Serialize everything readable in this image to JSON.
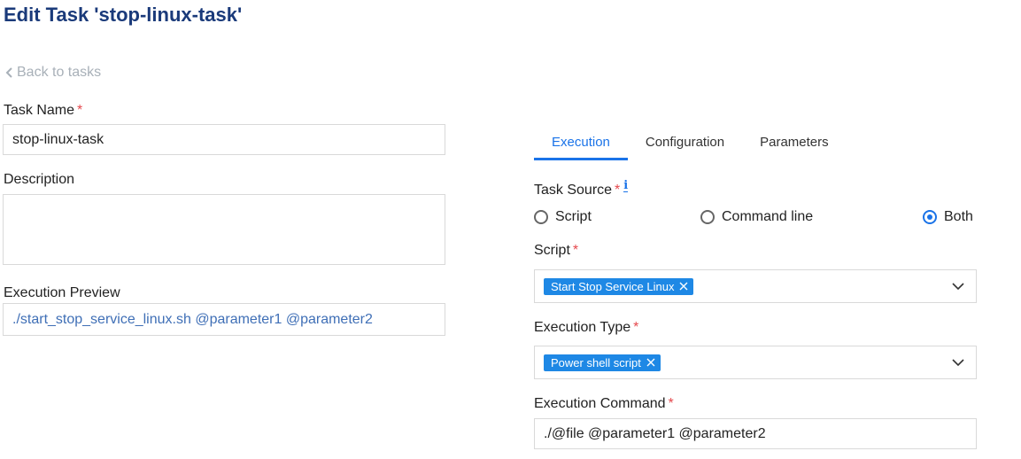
{
  "page": {
    "title": "Edit Task 'stop-linux-task'",
    "back_label": "Back to tasks"
  },
  "left": {
    "task_name_label": "Task Name",
    "task_name_value": "stop-linux-task",
    "description_label": "Description",
    "description_value": "",
    "preview_label": "Execution Preview",
    "preview_value": "./start_stop_service_linux.sh @parameter1 @parameter2"
  },
  "tabs": [
    {
      "label": "Execution",
      "active": true
    },
    {
      "label": "Configuration",
      "active": false
    },
    {
      "label": "Parameters",
      "active": false
    }
  ],
  "execution": {
    "task_source_label": "Task Source",
    "task_source_options": [
      "Script",
      "Command line",
      "Both"
    ],
    "task_source_selected": "Both",
    "script_label": "Script",
    "script_chip": "Start Stop Service Linux",
    "execution_type_label": "Execution Type",
    "execution_type_chip": "Power shell script",
    "command_label": "Execution Command",
    "command_value": "./@file @parameter1 @parameter2"
  },
  "required_marker": "*",
  "icons": {
    "back": "chevron-left-icon",
    "info": "info-icon",
    "dropdown": "chevron-down-icon",
    "remove": "close-icon"
  },
  "colors": {
    "title": "#1a3a7a",
    "accent": "#1a73e8",
    "chip": "#1e88e5",
    "required": "#e5484d",
    "preview_text": "#3f6fb6"
  }
}
